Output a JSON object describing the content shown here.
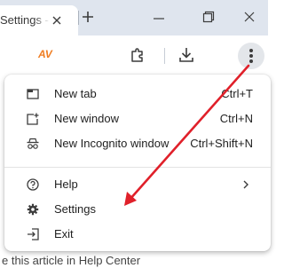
{
  "tab": {
    "title": "Settings - Do"
  },
  "page": {
    "link_text": "e this article in Help Center"
  },
  "toolbar": {
    "extension_logo_text": "AV"
  },
  "menu": {
    "items": [
      {
        "label": "New tab",
        "shortcut": "Ctrl+T",
        "icon": "new-tab-icon"
      },
      {
        "label": "New window",
        "shortcut": "Ctrl+N",
        "icon": "new-window-icon"
      },
      {
        "label": "New Incognito window",
        "shortcut": "Ctrl+Shift+N",
        "icon": "incognito-icon"
      },
      {
        "label": "Help",
        "shortcut": "",
        "icon": "help-icon"
      },
      {
        "label": "Settings",
        "shortcut": "",
        "icon": "gear-icon"
      },
      {
        "label": "Exit",
        "shortcut": "",
        "icon": "exit-icon"
      }
    ]
  },
  "colors": {
    "tabstrip": "#dfe5ee",
    "annotation_arrow": "#e0202a",
    "extension_logo": "#ef7d22",
    "menu_button_active": "#e3e6ea"
  }
}
